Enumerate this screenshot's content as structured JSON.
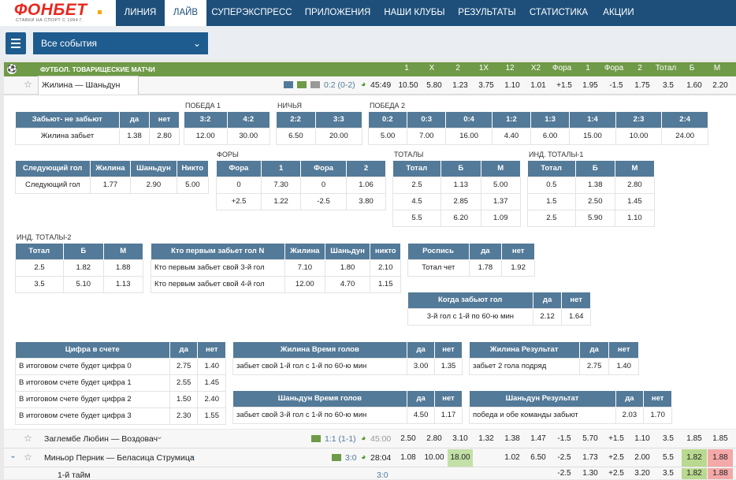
{
  "brand": {
    "name": "ФОНБЕТ",
    "tagline": "СТАВКИ НА СПОРТ С 1994 Г."
  },
  "nav": [
    "ЛИНИЯ",
    "ЛАЙВ",
    "СУПЕРЭКСПРЕСС",
    "ПРИЛОЖЕНИЯ",
    "НАШИ КЛУБЫ",
    "РЕЗУЛЬТАТЫ",
    "СТАТИСТИКА",
    "АКЦИИ"
  ],
  "filter": {
    "label": "Все события"
  },
  "league": {
    "title": "ФУТБОЛ. ТОВАРИЩЕСКИЕ МАТЧИ",
    "headers": [
      "1",
      "X",
      "2",
      "1X",
      "12",
      "X2",
      "Фора",
      "1",
      "Фора",
      "2",
      "Тотал",
      "Б",
      "М"
    ]
  },
  "match1": {
    "name": "Жилина — Шаньдун",
    "score": "0:2 (0-2)",
    "time": "45:49",
    "odds": [
      "10.50",
      "5.80",
      "1.23",
      "3.75",
      "1.10",
      "1.01",
      "+1.5",
      "1.95",
      "-1.5",
      "1.75",
      "3.5",
      "1.60",
      "2.20"
    ]
  },
  "match2": {
    "name": "Заглембе Любин — Воздовач",
    "score": "1:1 (1-1)",
    "time": "45:00",
    "odds": [
      "2.50",
      "2.80",
      "3.10",
      "1.32",
      "1.38",
      "1.47",
      "-1.5",
      "5.70",
      "+1.5",
      "1.10",
      "3.5",
      "1.85",
      "1.85"
    ]
  },
  "match3": {
    "name": "Миньор Перник — Беласица Струмица",
    "score": "3:0",
    "time": "28:04",
    "odds": [
      "1.08",
      "10.00",
      "18.00",
      "",
      "1.02",
      "6.50",
      "-2.5",
      "1.73",
      "+2.5",
      "2.00",
      "5.5",
      "1.82",
      "1.88"
    ]
  },
  "match4": {
    "name": "1-й тайм",
    "score": "3:0",
    "odds": [
      "",
      "",
      "",
      "",
      "",
      "",
      "-2.5",
      "1.30",
      "+2.5",
      "3.20",
      "3.5",
      "1.82",
      "1.88"
    ]
  },
  "t_score": {
    "headers": [
      "Забьют- не забьют",
      "да",
      "нет"
    ],
    "row": [
      "Жилина забьет",
      "1.38",
      "2.80"
    ]
  },
  "cap_win1": "ПОБЕДА 1",
  "cap_draw": "НИЧЬЯ",
  "cap_win2": "ПОБЕДА 2",
  "t_win1": {
    "headers": [
      "3:2",
      "4:2"
    ],
    "row": [
      "12.00",
      "30.00"
    ]
  },
  "t_draw": {
    "headers": [
      "2:2",
      "3:3"
    ],
    "row": [
      "6.50",
      "20.00"
    ]
  },
  "t_win2": {
    "headers": [
      "0:2",
      "0:3",
      "0:4",
      "1:2",
      "1:3",
      "1:4",
      "2:3",
      "2:4"
    ],
    "row": [
      "5.00",
      "7.00",
      "16.00",
      "4.40",
      "6.00",
      "15.00",
      "10.00",
      "24.00"
    ]
  },
  "cap_fory": "ФОРЫ",
  "cap_totals": "ТОТАЛЫ",
  "cap_ind1": "ИНД. ТОТАЛЫ-1",
  "cap_ind2": "ИНД. ТОТАЛЫ-2",
  "t_next": {
    "headers": [
      "Следующий гол",
      "Жилина",
      "Шаньдун",
      "Никто"
    ],
    "row": [
      "Следующий гол",
      "1.77",
      "2.90",
      "5.00"
    ]
  },
  "t_fora": {
    "headers": [
      "Фора",
      "1",
      "Фора",
      "2"
    ],
    "rows": [
      [
        "0",
        "7.30",
        "0",
        "1.06"
      ],
      [
        "+2.5",
        "1.22",
        "-2.5",
        "3.80"
      ]
    ]
  },
  "t_totals": {
    "headers": [
      "Тотал",
      "Б",
      "М"
    ],
    "rows": [
      [
        "2.5",
        "1.13",
        "5.00"
      ],
      [
        "4.5",
        "2.85",
        "1.37"
      ],
      [
        "5.5",
        "6.20",
        "1.09"
      ]
    ]
  },
  "t_ind1": {
    "headers": [
      "Тотал",
      "Б",
      "М"
    ],
    "rows": [
      [
        "0.5",
        "1.38",
        "2.80"
      ],
      [
        "1.5",
        "2.50",
        "1.45"
      ],
      [
        "2.5",
        "5.90",
        "1.10"
      ]
    ]
  },
  "t_ind2": {
    "headers": [
      "Тотал",
      "Б",
      "М"
    ],
    "rows": [
      [
        "2.5",
        "1.82",
        "1.88"
      ],
      [
        "3.5",
        "5.10",
        "1.13"
      ]
    ]
  },
  "t_first": {
    "headers": [
      "Кто первым забьет гол N",
      "Жилина",
      "Шаньдун",
      "никто"
    ],
    "rows": [
      [
        "Кто первым забьет свой 3-й гол",
        "7.10",
        "1.80",
        "2.10"
      ],
      [
        "Кто первым забьет свой 4-й гол",
        "12.00",
        "4.70",
        "1.15"
      ]
    ]
  },
  "t_sign": {
    "headers": [
      "Роспись",
      "да",
      "нет"
    ],
    "row": [
      "Тотал чет",
      "1.78",
      "1.92"
    ]
  },
  "t_when": {
    "headers": [
      "Когда забьют гол",
      "да",
      "нет"
    ],
    "row": [
      "3-й гол с 1-й по 60-ю мин",
      "2.12",
      "1.64"
    ]
  },
  "t_digit": {
    "headers": [
      "Цифра в счете",
      "да",
      "нет"
    ],
    "rows": [
      [
        "В итоговом счете будет цифра 0",
        "2.75",
        "1.40"
      ],
      [
        "В итоговом счете будет цифра 1",
        "2.55",
        "1.45"
      ],
      [
        "В итоговом счете будет цифра 2",
        "1.50",
        "2.40"
      ],
      [
        "В итоговом счете будет цифра 3",
        "2.30",
        "1.55"
      ]
    ]
  },
  "t_zt": {
    "headers": [
      "Жилина Время голов",
      "да",
      "нет"
    ],
    "row": [
      "забьет свой 1-й гол с 1-й по 60-ю мин",
      "3.00",
      "1.35"
    ]
  },
  "t_zr": {
    "headers": [
      "Жилина Результат",
      "да",
      "нет"
    ],
    "row": [
      "забьет 2 гола подряд",
      "2.75",
      "1.40"
    ]
  },
  "t_st": {
    "headers": [
      "Шаньдун Время голов",
      "да",
      "нет"
    ],
    "row": [
      "забьет свой 3-й гол с 1-й по 60-ю мин",
      "4.50",
      "1.17"
    ]
  },
  "t_sr": {
    "headers": [
      "Шаньдун Результат",
      "да",
      "нет"
    ],
    "row": [
      "победа и обе команды забьют",
      "2.03",
      "1.70"
    ]
  }
}
